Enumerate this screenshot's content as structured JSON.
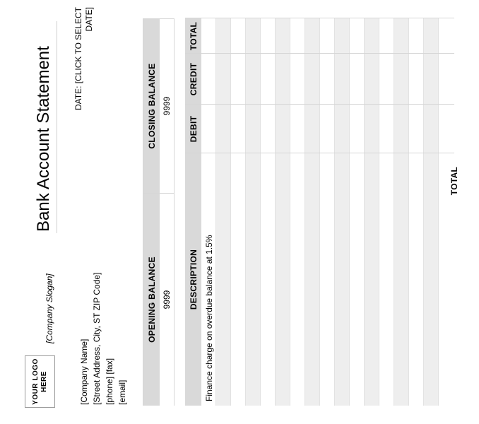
{
  "header": {
    "logo_line1": "YOUR LOGO",
    "logo_line2": "HERE",
    "slogan": "[Company Slogan]",
    "title": "Bank Account Statement",
    "date_line1": "DATE: [CLICK TO SELECT",
    "date_line2": "DATE]"
  },
  "company": {
    "name": "[Company Name]",
    "address": "[Street Address, City, ST  ZIP Code]",
    "phone_fax": "[phone]  [fax]",
    "email": "[email]"
  },
  "balances": {
    "opening_label": "OPENING BALANCE",
    "opening_value": "9999",
    "closing_label": "CLOSING BALANCE",
    "closing_value": "9999"
  },
  "transactions": {
    "columns": [
      "DESCRIPTION",
      "DEBIT",
      "CREDIT",
      "TOTAL"
    ],
    "rows": [
      {
        "description": "Finance charge on overdue balance at 1.5%",
        "debit": "",
        "credit": "",
        "total": ""
      },
      {
        "description": "",
        "debit": "",
        "credit": "",
        "total": ""
      },
      {
        "description": "",
        "debit": "",
        "credit": "",
        "total": ""
      },
      {
        "description": "",
        "debit": "",
        "credit": "",
        "total": ""
      },
      {
        "description": "",
        "debit": "",
        "credit": "",
        "total": ""
      },
      {
        "description": "",
        "debit": "",
        "credit": "",
        "total": ""
      },
      {
        "description": "",
        "debit": "",
        "credit": "",
        "total": ""
      },
      {
        "description": "",
        "debit": "",
        "credit": "",
        "total": ""
      },
      {
        "description": "",
        "debit": "",
        "credit": "",
        "total": ""
      },
      {
        "description": "",
        "debit": "",
        "credit": "",
        "total": ""
      },
      {
        "description": "",
        "debit": "",
        "credit": "",
        "total": ""
      },
      {
        "description": "",
        "debit": "",
        "credit": "",
        "total": ""
      },
      {
        "description": "",
        "debit": "",
        "credit": "",
        "total": ""
      },
      {
        "description": "",
        "debit": "",
        "credit": "",
        "total": ""
      },
      {
        "description": "",
        "debit": "",
        "credit": "",
        "total": ""
      },
      {
        "description": "",
        "debit": "",
        "credit": "",
        "total": ""
      }
    ],
    "total_label": "TOTAL",
    "total_value": ""
  },
  "colors": {
    "header_fill": "#d9d9d9",
    "row_shade": "#eeeeee",
    "grid_line": "#d6d6d6"
  }
}
